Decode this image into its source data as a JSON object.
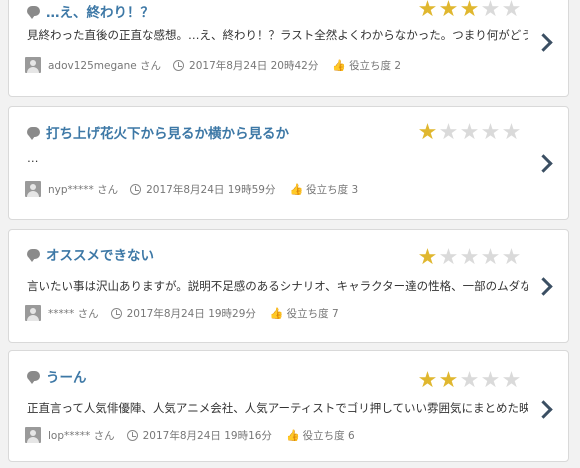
{
  "reviews": [
    {
      "title": "…え、終わり！？",
      "stars": 3,
      "body": "見終わった直後の正直な感想。…え、終わり！？ラスト全然よくわからなかった。つまり何がどうなった…",
      "user": "adov125megane さん",
      "date": "2017年8月24日 20時42分",
      "helpful": "役立ち度 2"
    },
    {
      "title": "打ち上げ花火下から見るか横から見るか",
      "stars": 1,
      "body": "…",
      "user": "nyp***** さん",
      "date": "2017年8月24日 19時59分",
      "helpful": "役立ち度 3"
    },
    {
      "title": "オススメできない",
      "stars": 1,
      "body": "言いたい事は沢山ありますが。説明不足感のあるシナリオ、キャラクター達の性格、一部のムダな演出…",
      "user": "***** さん",
      "date": "2017年8月24日 19時29分",
      "helpful": "役立ち度 7"
    },
    {
      "title": "うーん",
      "stars": 2,
      "body": "正直言って人気俳優陣、人気アニメ会社、人気アーティストでゴリ押していい雰囲気にまとめた映画。個…",
      "user": "lop***** さん",
      "date": "2017年8月24日 19時16分",
      "helpful": "役立ち度 6"
    }
  ],
  "max_stars": 5,
  "colors": {
    "title": "#3d78a6",
    "star_on": "#e0b72f",
    "star_off": "#dadada",
    "chevron": "#3b4f63"
  },
  "icons": {
    "comment": "speech-bubble-icon",
    "user": "user-avatar-icon",
    "time": "clock-icon",
    "helpful": "thumbs-up-icon",
    "more": "chevron-right-icon"
  }
}
